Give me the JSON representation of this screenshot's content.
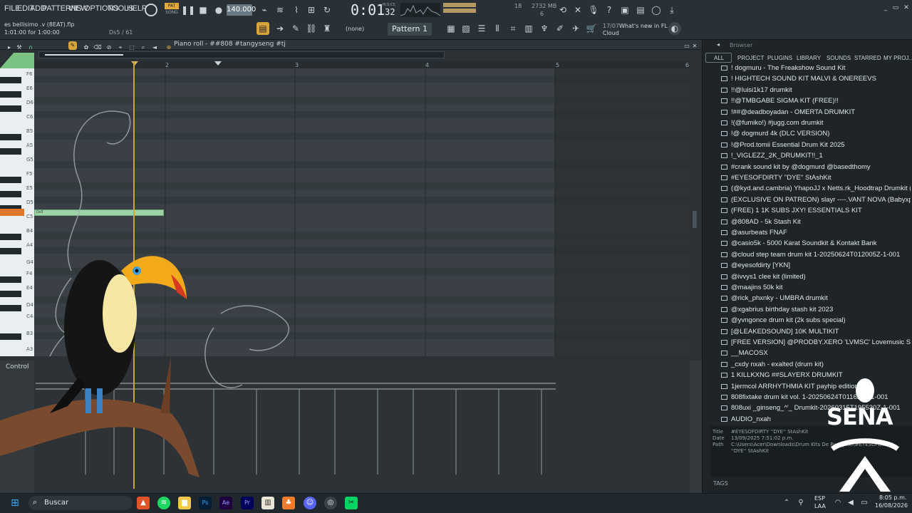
{
  "menu": [
    "FILE",
    "EDIT",
    "ADD",
    "PATTERNS",
    "VIEW",
    "OPTIONS",
    "TOOLS",
    "HELP"
  ],
  "project": {
    "filename": "es bellisimo .v (8EAT).flp",
    "position": "1:01:00 for 1:00:00",
    "note_readout": "Ds5 / 61"
  },
  "transport": {
    "mode_top": "PAT",
    "mode_bottom": "SONG",
    "tempo": "140.000",
    "time": "0:01",
    "time_sub": "32",
    "time_unit": "M:S:CS"
  },
  "perf": {
    "memory": "2732 MB",
    "cpu": "18",
    "poly": "6"
  },
  "pattern": {
    "name": "Pattern 1",
    "snap": "(none)"
  },
  "news": {
    "date": "17/07",
    "text": "What's new in FL",
    "text2": "Cloud"
  },
  "roll": {
    "title": "Piano roll - ##808 #tangyseng #tj",
    "control_label": "Control",
    "note_label": "Ds5",
    "bars": [
      "2",
      "3",
      "4",
      "5",
      "6"
    ]
  },
  "keys": [
    "F6",
    "E6",
    "D6",
    "C6",
    "B5",
    "A5",
    "G5",
    "F5",
    "E5",
    "D5",
    "C5",
    "B4",
    "A4",
    "G4",
    "F4",
    "E4",
    "D4",
    "C4",
    "B3",
    "A3"
  ],
  "browser": {
    "title": "Browser",
    "tabs": [
      "ALL",
      "PROJECT",
      "PLUGINS",
      "LIBRARY",
      "SOUNDS",
      "STARRED",
      "MY PROJ.."
    ],
    "items": [
      "! dogmuru - The Freakshow Sound Kit",
      "! HIGHTECH SOUND KIT MALVI & ONEREEVS",
      "!!@luisi1k17 drumkit",
      "!!@TMBGABE SIGMA KIT (FREE)!!",
      "!##@deadboyadan - OMERTA DRUMKIT",
      "!(@fumiko!) #jugg.com drumkit",
      "!@ dogmurd 4k (DLC VERSION)",
      "!@Prod.tomii Essential Drum Kit 2025",
      "!_VIGLEZZ_2K_DRUMKIT!!_1",
      "#crank sound kit by @dogmurd @basedthomy",
      "#EYESOFDIRTY ''DYE'' StAshKit",
      "(@kyd.and.cambria) YhapoJJ x Netts.rk_Hoodtrap Drumkit (Rare Shit)",
      "(EXCLUSIVE ON PATREON) slayr ----.VANT NOVA (Babyxprod Bangtozzy)",
      "(FREE) 1 1K SUBS JXY! ESSENTIALS KIT",
      "@808AD - 5k Stash Kit",
      "@asurbeats FNAF",
      "@casio5k - 5000 Karat Soundkit & Kontakt Bank",
      "@cloud step team drum kit 1-20250624T012005Z-1-001",
      "@eyesofdirty [YKN]",
      "@ivvys1 clee kit (limited)",
      "@maajins 50k kit",
      "@rick_phxnky - UMBRA drumkit",
      "@xgabrius birthday stash kit 2023",
      "@yvngonce drum kit (2k subs special)",
      "[@LEAKEDSOUND] 10K MULTIKIT",
      "[FREE VERSION] @PRODBY.XERO 'LVMSC' Lovemusic Sound Kit",
      "__MACOSX",
      "_cxdy nxah - exalted (drum kit)",
      "1 KILLKXNG ##SLAYERX DRUMKIT",
      "1jermcol ARRHYTHMIA KIT payhip edition",
      "808fixtake drum kit vol. 1-20250624T011621Z-1-001",
      "808uxi _ginseng_^'_ Drumkit-20260315T195530Z-1-001",
      "AUDIO_nxah"
    ],
    "info": {
      "title_label": "Title",
      "title": "#EYESOFDIRTY ''DYE'' StAshKit",
      "date_label": "Date",
      "date": "13/09/2025 7:51:02 p.m.",
      "path_label": "Path",
      "path": "C:\\Users\\Acer\\Downloads\\Drum Kits De Puro Jose\\#EYESOFDIRTY ''DYE'' StAshKit",
      "tags_label": "TAGS"
    }
  },
  "taskbar": {
    "search": "Buscar",
    "lang": "ESP",
    "lang2": "LAA",
    "time": "8:05 p.m.",
    "date": "16/08/2026"
  },
  "watermark": "SENA"
}
